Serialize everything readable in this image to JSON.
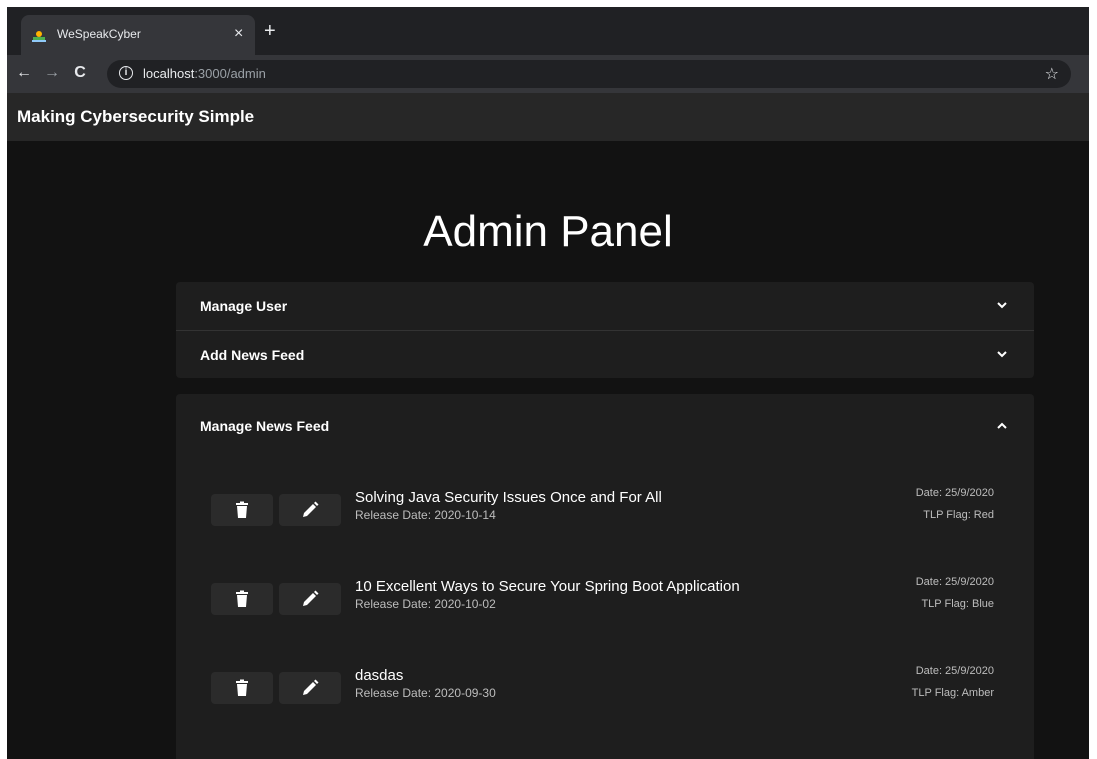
{
  "browser": {
    "tab_title": "WeSpeakCyber",
    "close_glyph": "×",
    "new_tab_glyph": "+",
    "back_glyph": "←",
    "forward_glyph": "→",
    "reload_glyph": "C",
    "info_glyph": "i",
    "url_host": "localhost",
    "url_path": ":3000/admin",
    "star_glyph": "☆"
  },
  "app": {
    "title": "Making Cybersecurity Simple"
  },
  "page": {
    "title": "Admin Panel"
  },
  "panels": [
    {
      "label": "Manage User",
      "expanded": false
    },
    {
      "label": "Add News Feed",
      "expanded": false
    },
    {
      "label": "Manage News Feed",
      "expanded": true
    }
  ],
  "news": [
    {
      "title": "Solving Java Security Issues Once and For All",
      "release": "Release Date: 2020-10-14",
      "date": "Date: 25/9/2020",
      "tlp": "TLP Flag: Red"
    },
    {
      "title": "10 Excellent Ways to Secure Your Spring Boot Application",
      "release": "Release Date: 2020-10-02",
      "date": "Date: 25/9/2020",
      "tlp": "TLP Flag: Blue"
    },
    {
      "title": "dasdas",
      "release": "Release Date: 2020-09-30",
      "date": "Date: 25/9/2020",
      "tlp": "TLP Flag: Amber"
    }
  ],
  "icons": {
    "delete": "trash-icon",
    "edit": "pencil-icon",
    "collapse_closed": "chevron-down-icon",
    "collapse_open": "chevron-up-icon"
  }
}
